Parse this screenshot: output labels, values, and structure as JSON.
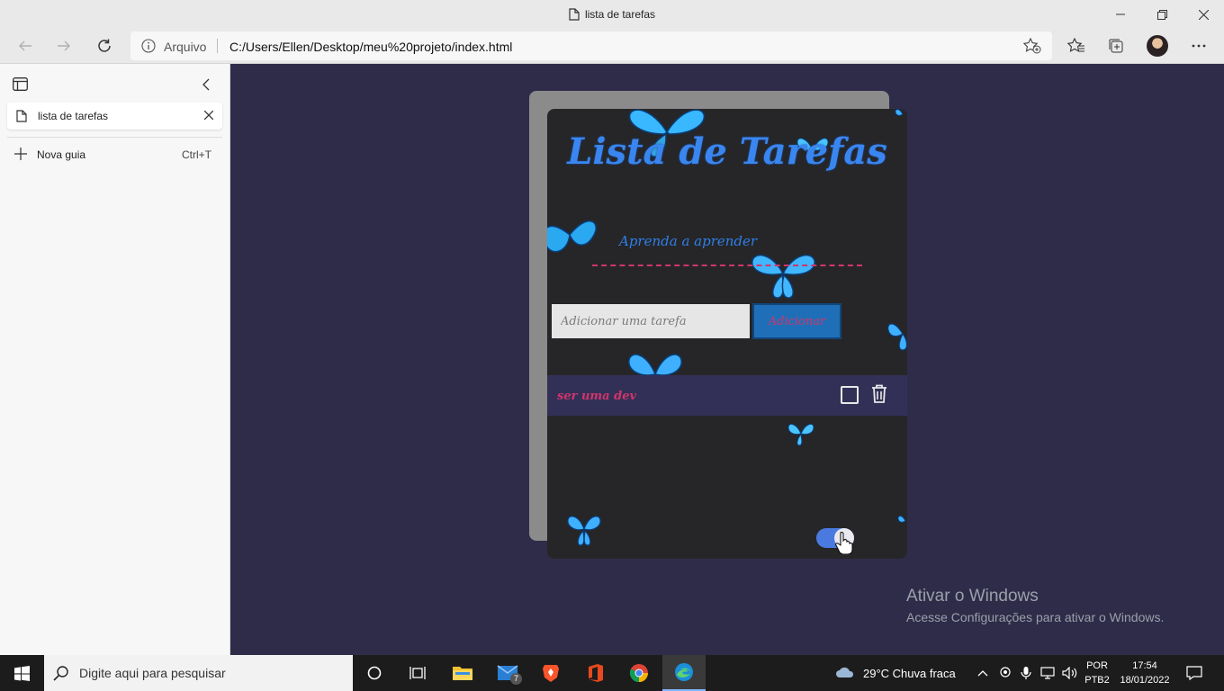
{
  "window": {
    "title": "lista de tarefas"
  },
  "addressbar": {
    "scheme_label": "Arquivo",
    "url": "C:/Users/Ellen/Desktop/meu%20projeto/index.html"
  },
  "sidebar": {
    "tabs": [
      {
        "label": "lista de tarefas"
      }
    ],
    "new_tab": {
      "label": "Nova guia",
      "shortcut": "Ctrl+T"
    }
  },
  "app": {
    "title": "Lista de Tarefas",
    "subtitle": "Aprenda a aprender",
    "input_placeholder": "Adicionar uma tarefa",
    "add_button": "Adicionar",
    "tasks": [
      {
        "text": "ser uma dev",
        "done": false
      }
    ],
    "theme_toggle_on": true,
    "colors": {
      "page_bg": "#2f2c4a",
      "card_bg": "#262628",
      "accent_blue": "#3a86f0",
      "accent_pink": "#d1356a"
    }
  },
  "watermark": {
    "line1": "Ativar o Windows",
    "line2": "Acesse Configurações para ativar o Windows."
  },
  "taskbar": {
    "search_placeholder": "Digite aqui para pesquisar",
    "mail_badge": "7",
    "weather": "29°C  Chuva fraca",
    "lang_line1": "POR",
    "lang_line2": "PTB2",
    "time": "17:54",
    "date": "18/01/2022"
  }
}
